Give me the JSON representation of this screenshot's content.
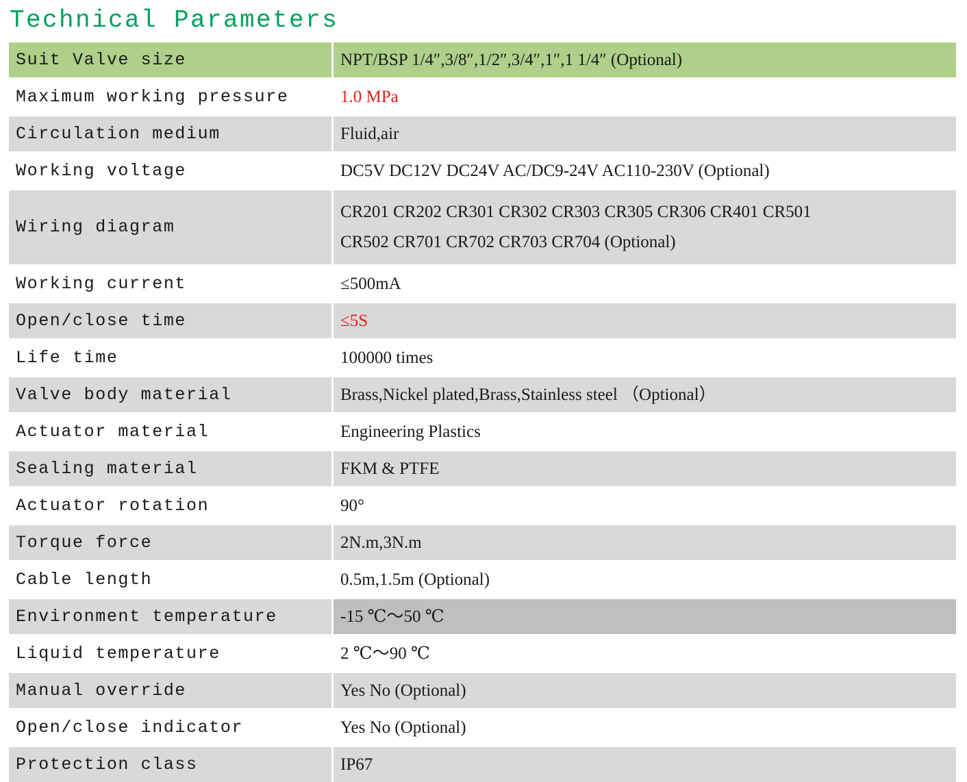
{
  "page": {
    "title": "Technical Parameters",
    "title_color": "#00a15b",
    "background": "#ffffff"
  },
  "colors": {
    "header_green": "#aed08a",
    "row_gray": "#d9d9d9",
    "row_highlight_gray": "#bfbfbf",
    "row_white": "#ffffff",
    "accent_red": "#e0201b",
    "text": "#1a1a1a"
  },
  "table": {
    "rows": [
      {
        "label": "Suit Valve size",
        "value": "NPT/BSP 1/4″,3/8″,1/2″,3/4″,1″,1 1/4″ (Optional)",
        "band": "green",
        "value_color": "#1a1a1a"
      },
      {
        "label": "Maximum working pressure",
        "value": "1.0 MPa",
        "band": "white",
        "value_color": "#e0201b"
      },
      {
        "label": "Circulation medium",
        "value": "Fluid,air",
        "band": "gray",
        "value_color": "#1a1a1a"
      },
      {
        "label": "Working voltage",
        "value": "DC5V DC12V DC24V AC/DC9-24V AC110-230V (Optional)",
        "band": "gray-alt-white",
        "value_color": "#1a1a1a"
      },
      {
        "label": "Wiring diagram",
        "value": "CR201 CR202 CR301 CR302 CR303 CR305 CR306 CR401 CR501\nCR502 CR701 CR702 CR703 CR704 (Optional)",
        "band": "gray",
        "value_color": "#1a1a1a"
      },
      {
        "label": "Working current",
        "value": "≤500mA",
        "band": "white",
        "value_color": "#1a1a1a"
      },
      {
        "label": "Open/close time",
        "value": "≤5S",
        "band": "gray",
        "value_color": "#e0201b"
      },
      {
        "label": "Life time",
        "value": "100000 times",
        "band": "white",
        "value_color": "#1a1a1a"
      },
      {
        "label": "Valve body material",
        "value": "Brass,Nickel plated,Brass,Stainless steel （Optional）",
        "band": "gray",
        "value_color": "#1a1a1a"
      },
      {
        "label": "Actuator material",
        "value": "Engineering Plastics",
        "band": "white",
        "value_color": "#1a1a1a"
      },
      {
        "label": "Sealing material",
        "value": "FKM & PTFE",
        "band": "gray",
        "value_color": "#1a1a1a"
      },
      {
        "label": "Actuator rotation",
        "value": "90°",
        "band": "white",
        "value_color": "#1a1a1a"
      },
      {
        "label": "Torque force",
        "value": "2N.m,3N.m",
        "band": "gray",
        "value_color": "#1a1a1a"
      },
      {
        "label": "Cable length",
        "value": "0.5m,1.5m (Optional)",
        "band": "white",
        "value_color": "#1a1a1a"
      },
      {
        "label": "Environment temperature",
        "value": "-15 ℃～50 ℃",
        "band": "highlight",
        "value_color": "#1a1a1a"
      },
      {
        "label": "Liquid temperature",
        "value": "2 ℃～90 ℃",
        "band": "white",
        "value_color": "#1a1a1a"
      },
      {
        "label": "Manual override",
        "value": "Yes No (Optional)",
        "band": "gray",
        "value_color": "#1a1a1a"
      },
      {
        "label": "Open/close indicator",
        "value": "Yes No (Optional)",
        "band": "white",
        "value_color": "#1a1a1a"
      },
      {
        "label": "Protection class",
        "value": "IP67",
        "band": "gray",
        "value_color": "#1a1a1a"
      }
    ]
  }
}
